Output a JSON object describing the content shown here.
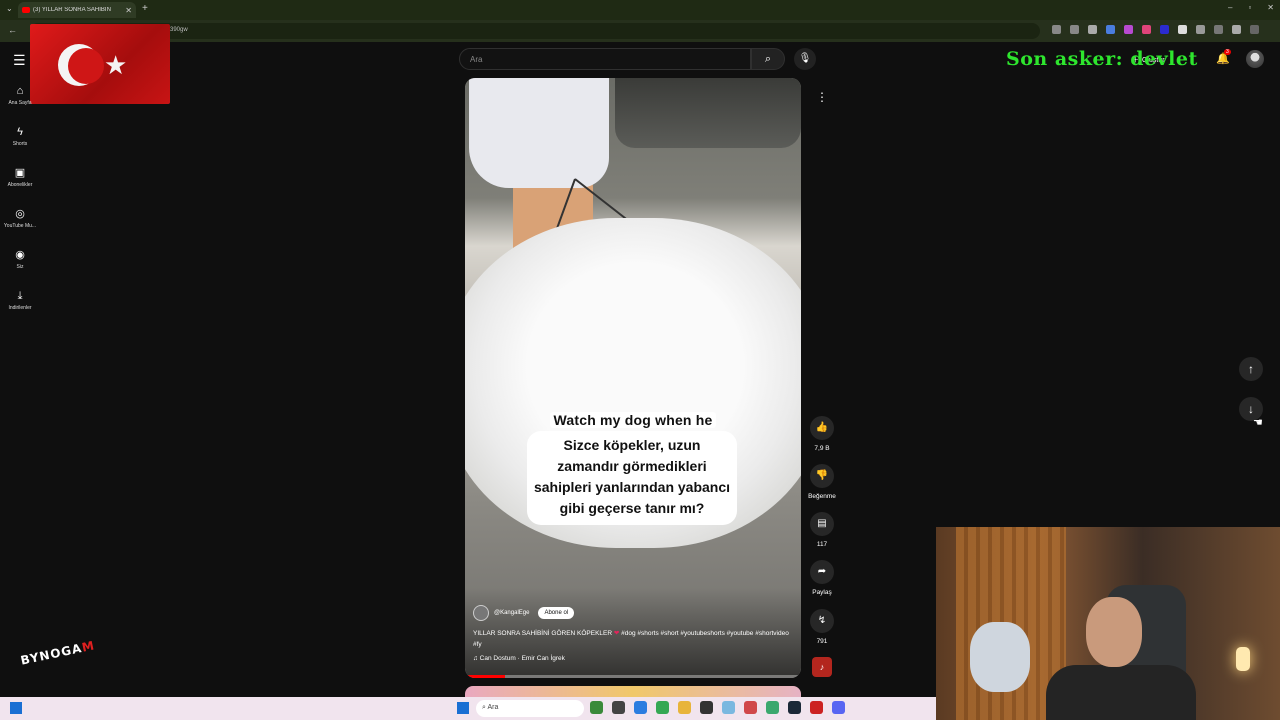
{
  "browser": {
    "tab_title": "(3) YILLAR SONRA SAHİBİN",
    "url_fragment": "390gw",
    "new_tab": "+",
    "window_controls": [
      "–",
      "▫",
      "✕"
    ]
  },
  "overlay": {
    "stream_text": "Son asker: devlet"
  },
  "youtube": {
    "sidebar": {
      "items": [
        {
          "label": "Ana Sayfa",
          "icon": "home-icon"
        },
        {
          "label": "Shorts",
          "icon": "shorts-icon"
        },
        {
          "label": "Abonelikler",
          "icon": "subscriptions-icon"
        },
        {
          "label": "YouTube Mu...",
          "icon": "youtube-music-icon"
        },
        {
          "label": "Siz",
          "icon": "you-icon"
        },
        {
          "label": "İndirilenler",
          "icon": "download-icon"
        }
      ]
    },
    "search": {
      "placeholder": "Ara"
    },
    "header": {
      "create_label": "Oluştur",
      "notifications_badge": "3"
    },
    "short": {
      "overlay_text": "Watch my dog when he",
      "caption": "Sizce köpekler, uzun zamandır görmedikleri sahipleri yanlarından yabancı gibi geçerse tanır mı?",
      "channel_name": "@KangalEge",
      "subscribe_label": "Abone ol",
      "title_part1": "YILLAR SONRA SAHİBİNİ GÖREN KÖPEKLER",
      "heart": "❤",
      "title_part2": "#dog #shorts #short #youtubeshorts #youtube #shortvideo #fy",
      "song": "♫ Can Dostum · Emir Can İgrek",
      "progress": 0.12
    },
    "actions": {
      "like_count": "7,9 B",
      "dislike_label": "Beğenme",
      "comment_count": "117",
      "share_label": "Paylaş",
      "remix_count": "791"
    }
  },
  "watermark": {
    "logo_text": "BYNOGA",
    "logo_accent": "M"
  },
  "taskbar": {
    "search_placeholder": "Ara"
  },
  "colors": {
    "accent_red": "#ff0000",
    "overlay_green": "#2ee62e",
    "taskbar": "#f1e4ee"
  }
}
